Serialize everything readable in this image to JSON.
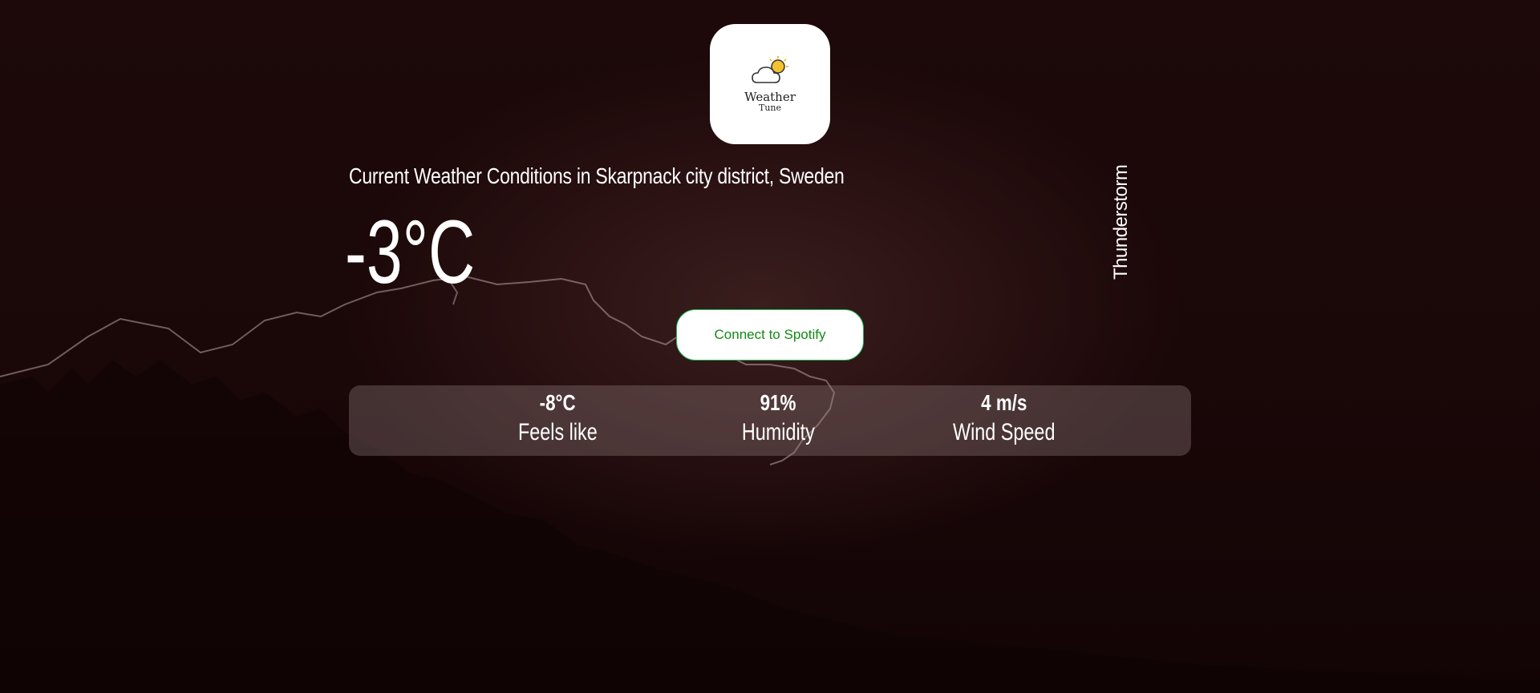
{
  "app": {
    "logo_title": "Weather",
    "logo_subtitle": "Tune"
  },
  "weather": {
    "location_text": "Current Weather Conditions in Skarpnack city district, Sweden",
    "temperature": "-3°C",
    "condition": "Thunderstorm"
  },
  "actions": {
    "spotify_label": "Connect to Spotify"
  },
  "stats": [
    {
      "value": "-8°C",
      "label": "Feels like"
    },
    {
      "value": "91%",
      "label": "Humidity"
    },
    {
      "value": "4 m/s",
      "label": "Wind Speed"
    }
  ],
  "colors": {
    "background": "#170607",
    "spotify_text": "#128a12",
    "spotify_border": "#1db954",
    "text": "#ffffff"
  }
}
